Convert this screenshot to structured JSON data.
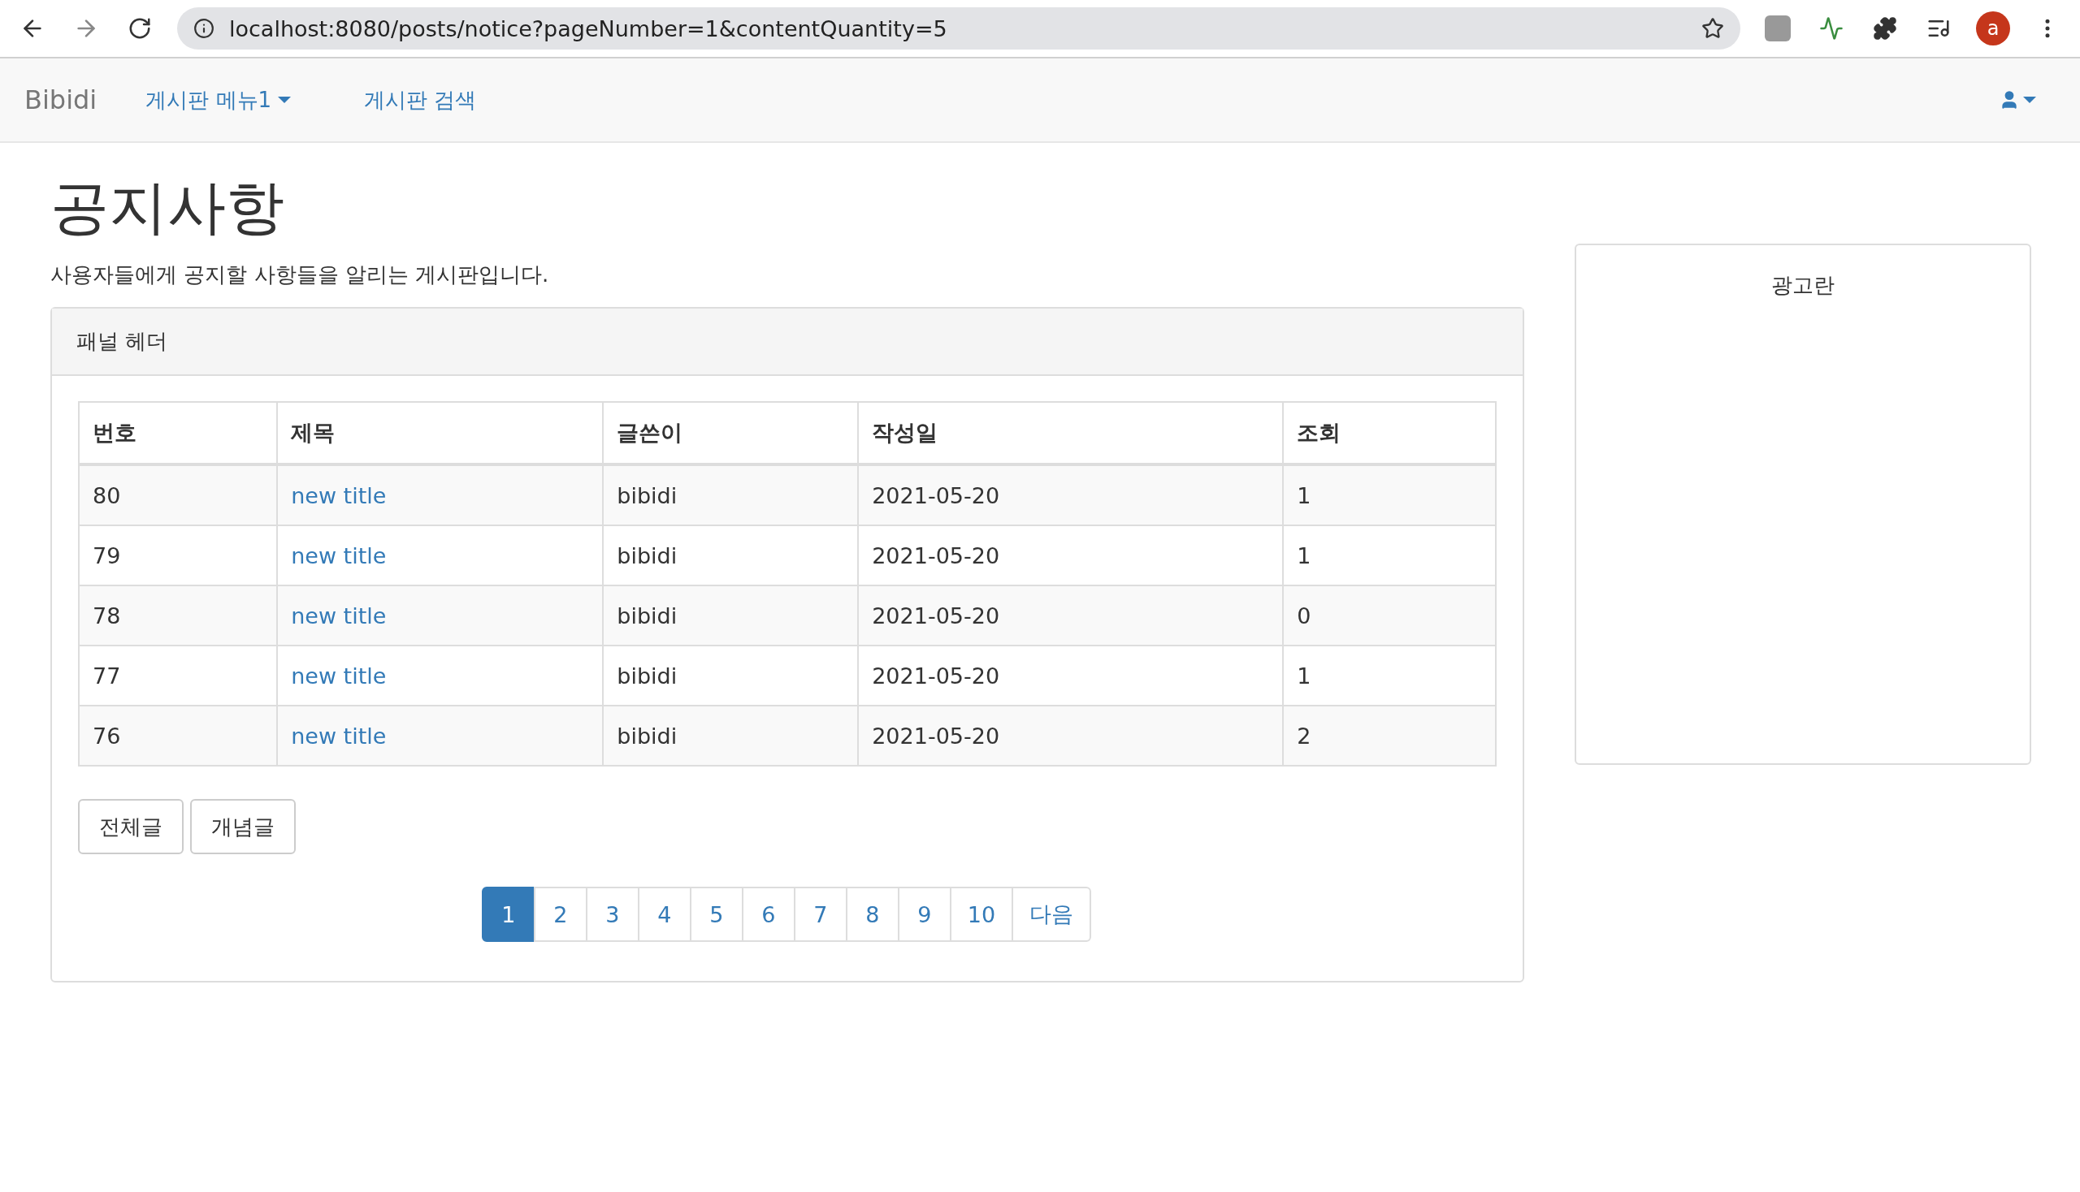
{
  "browser": {
    "url": "localhost:8080/posts/notice?pageNumber=1&contentQuantity=5",
    "profile_initial": "a"
  },
  "navbar": {
    "brand": "Bibidi",
    "items": [
      {
        "label": "게시판 메뉴1",
        "dropdown": true
      },
      {
        "label": "게시판 검색",
        "dropdown": false
      }
    ]
  },
  "page": {
    "title": "공지사항",
    "description": "사용자들에게 공지할 사항들을 알리는 게시판입니다."
  },
  "panel": {
    "header": "패널 헤더",
    "table": {
      "columns": [
        "번호",
        "제목",
        "글쓴이",
        "작성일",
        "조회"
      ],
      "rows": [
        {
          "cells": [
            "80",
            "new title",
            "bibidi",
            "2021-05-20",
            "1"
          ]
        },
        {
          "cells": [
            "79",
            "new title",
            "bibidi",
            "2021-05-20",
            "1"
          ]
        },
        {
          "cells": [
            "78",
            "new title",
            "bibidi",
            "2021-05-20",
            "0"
          ]
        },
        {
          "cells": [
            "77",
            "new title",
            "bibidi",
            "2021-05-20",
            "1"
          ]
        },
        {
          "cells": [
            "76",
            "new title",
            "bibidi",
            "2021-05-20",
            "2"
          ]
        }
      ]
    },
    "buttons": [
      "전체글",
      "개념글"
    ],
    "pagination": [
      {
        "label": "1",
        "selected": true
      },
      {
        "label": "2",
        "selected": false
      },
      {
        "label": "3",
        "selected": false
      },
      {
        "label": "4",
        "selected": false
      },
      {
        "label": "5",
        "selected": false
      },
      {
        "label": "6",
        "selected": false
      },
      {
        "label": "7",
        "selected": false
      },
      {
        "label": "8",
        "selected": false
      },
      {
        "label": "9",
        "selected": false
      },
      {
        "label": "10",
        "selected": false
      },
      {
        "label": "다음",
        "selected": false
      }
    ]
  },
  "sidebar": {
    "ad_label": "광고란"
  }
}
